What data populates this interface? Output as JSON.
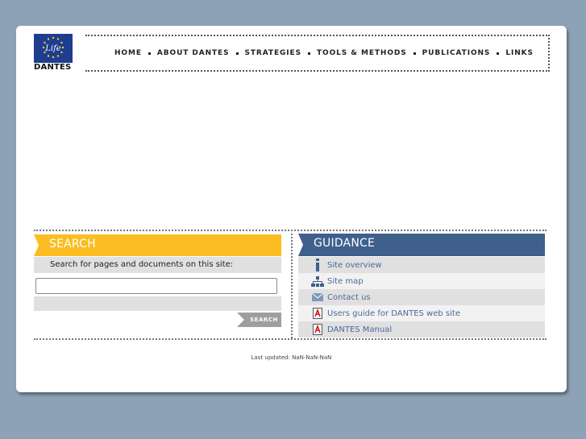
{
  "logo": {
    "text": "DANTES",
    "emblem_text": "Life"
  },
  "nav": {
    "items": [
      {
        "label": "HOME"
      },
      {
        "label": "ABOUT DANTES"
      },
      {
        "label": "STRATEGIES"
      },
      {
        "label": "TOOLS & METHODS"
      },
      {
        "label": "PUBLICATIONS"
      },
      {
        "label": "LINKS"
      }
    ]
  },
  "search": {
    "title": "SEARCH",
    "description": "Search for pages and documents on this site:",
    "input_value": "",
    "button_label": "SEARCH"
  },
  "guidance": {
    "title": "GUIDANCE",
    "items": [
      {
        "label": "Site overview",
        "icon": "info-icon"
      },
      {
        "label": "Site map",
        "icon": "sitemap-icon"
      },
      {
        "label": "Contact us",
        "icon": "mail-icon"
      },
      {
        "label": "Users guide for DANTES web site",
        "icon": "pdf-icon"
      },
      {
        "label": "DANTES Manual",
        "icon": "pdf-icon"
      }
    ]
  },
  "footer": {
    "text": "Last updated: NaN-NaN-NaN"
  },
  "colors": {
    "background": "#8da2b6",
    "search_accent": "#fbbd21",
    "guidance_accent": "#3f5f8c",
    "link": "#4a6a9a"
  }
}
